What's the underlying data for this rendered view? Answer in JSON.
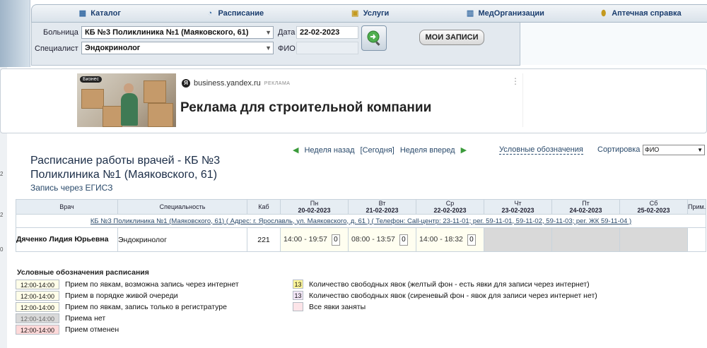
{
  "nav": {
    "items": [
      {
        "label": "Каталог",
        "icon": "catalog-icon"
      },
      {
        "label": "Расписание",
        "icon": "schedule-icon"
      },
      {
        "label": "Услуги",
        "icon": "services-icon"
      },
      {
        "label": "МедОрганизации",
        "icon": "book-icon"
      },
      {
        "label": "Аптечная справка",
        "icon": "pill-icon"
      }
    ]
  },
  "search": {
    "hospital_label": "Больница",
    "hospital_value": "КБ №3 Поликлиника №1 (Маяковского, 61)",
    "specialist_label": "Специалист",
    "specialist_value": "Эндокринолог",
    "date_label": "Дата",
    "date_value": "22-02-2023",
    "fio_label": "ФИО",
    "fio_value": "",
    "my_records_label": "МОИ ЗАПИСИ"
  },
  "ad": {
    "badge": "Бизнес",
    "site": "business.yandex.ru",
    "tag": "РЕКЛАМА",
    "title": "Реклама для строительной компании"
  },
  "page": {
    "title": "Расписание работы врачей - КБ №3 Поликлиника №1 (Маяковского, 61)",
    "subtitle": "Запись через ЕГИСЗ",
    "week_back": "Неделя назад",
    "today": "[Сегодня]",
    "week_forward": "Неделя вперед",
    "legend_link": "Условные обозначения",
    "sort_label": "Сортировка",
    "sort_value": "ФИО"
  },
  "table": {
    "headers": {
      "doctor": "Врач",
      "specialty": "Специальность",
      "cabinet": "Каб",
      "note": "Прим."
    },
    "days": [
      {
        "name": "Пн",
        "date": "20-02-2023"
      },
      {
        "name": "Вт",
        "date": "21-02-2023"
      },
      {
        "name": "Ср",
        "date": "22-02-2023"
      },
      {
        "name": "Чт",
        "date": "23-02-2023"
      },
      {
        "name": "Пт",
        "date": "24-02-2023"
      },
      {
        "name": "Сб",
        "date": "25-02-2023"
      }
    ],
    "info": "КБ №3 Поликлиника №1 (Маяковского, 61) ( Адрес: г. Ярославль, ул. Маяковского, д. 61 ) ( Телефон: Call-центр: 23-11-01; рег. 59-11-01, 59-11-02, 59-11-03; рег. ЖК 59-11-04 )",
    "doctor": {
      "name": "Дяченко Лидия Юрьевна",
      "specialty": "Эндокринолог",
      "cabinet": "221",
      "slots": [
        {
          "time": "14:00 - 19:57",
          "count": "0"
        },
        {
          "time": "08:00 - 13:57",
          "count": "0"
        },
        {
          "time": "14:00 - 18:32",
          "count": "0"
        }
      ]
    }
  },
  "legend": {
    "title": "Условные обозначения расписания",
    "rows": [
      {
        "box": "12:00-14:00",
        "text": "Прием по явкам, возможна запись через интернет",
        "bg": "#fffde8"
      },
      {
        "box": "12:00-14:00",
        "text": "Прием в порядке живой очереди",
        "bg": "#fffde8"
      },
      {
        "box": "12:00-14:00",
        "text": "Прием по явкам, запись только в регистратуре",
        "bg": "#fffde8"
      },
      {
        "box": "12:00-14:00",
        "text": "Приема нет",
        "bg": "#d9d9d9"
      },
      {
        "box": "12:00-14:00",
        "text": "Прием отменен",
        "bg": "#ffd9d9"
      }
    ],
    "counts": [
      {
        "box": "13",
        "text": "Количество свободных явок (желтый фон - есть явки для записи через интернет)",
        "bg": "#fff79a"
      },
      {
        "box": "13",
        "text": "Количество свободных явок (сиреневый фон - явок для записи через интернет нет)",
        "bg": "#f3e6f7"
      },
      {
        "box": "",
        "text": "Все явки заняты",
        "bg": "#fce4e8"
      }
    ]
  },
  "colors": {
    "brand": "#1a3d6e",
    "nav_bg": "#d9e2ea",
    "link": "#2a4a6b",
    "arrow_green": "#3b9b3b"
  }
}
